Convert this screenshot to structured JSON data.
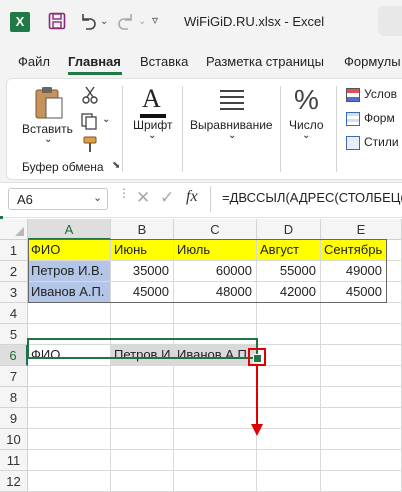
{
  "titlebar": {
    "filename": "WiFiGiD.RU.xlsx",
    "separator": "-",
    "app": "Excel"
  },
  "tabs": [
    {
      "label": "Файл"
    },
    {
      "label": "Главная"
    },
    {
      "label": "Вставка"
    },
    {
      "label": "Разметка страницы"
    },
    {
      "label": "Формулы"
    }
  ],
  "ribbon": {
    "paste": "Вставить",
    "font": "Шрифт",
    "alignment": "Выравнивание",
    "number": "Число",
    "percent_glyph": "%",
    "font_glyph": "A",
    "clipboard_group": "Буфер обмена",
    "styles": [
      "Услов",
      "Форм",
      "Стили"
    ]
  },
  "formula_bar": {
    "name_box": "A6",
    "fx": "fx",
    "formula": "=ДВССЫЛ(АДРЕС(СТОЛБЕЦ(А"
  },
  "grid": {
    "columns": [
      "A",
      "B",
      "C",
      "D",
      "E"
    ],
    "selected_column": "A",
    "rows": [
      "1",
      "2",
      "3",
      "4",
      "5",
      "6",
      "7",
      "8",
      "9",
      "10",
      "11",
      "12"
    ],
    "selected_row": "6",
    "data": {
      "r1": [
        "ФИО",
        "Июнь",
        "Июль",
        "Август",
        "Сентябрь"
      ],
      "r2": [
        "Петров И.В.",
        "35000",
        "60000",
        "55000",
        "49000"
      ],
      "r3": [
        "Иванов А.П.",
        "45000",
        "48000",
        "42000",
        "45000"
      ],
      "r6": [
        "ФИО",
        "Петров И.В.",
        "Иванов А.П."
      ]
    }
  },
  "colors": {
    "header_fill": "#ffff00",
    "name_fill": "#b4c6e7",
    "transposed_fill": "#d9d9d9",
    "selection": "#217346",
    "annotation": "#e00000",
    "excel_green": "#1f7a45"
  }
}
